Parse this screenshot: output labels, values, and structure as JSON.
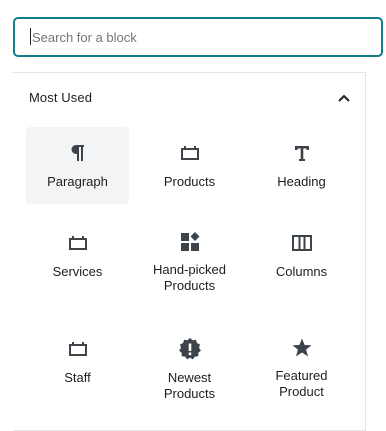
{
  "search": {
    "placeholder": "Search for a block",
    "value": ""
  },
  "section": {
    "title": "Most Used",
    "expanded": true
  },
  "accent_color": "#0f7d8a",
  "blocks": [
    {
      "label": "Paragraph",
      "icon": "paragraph-icon",
      "hovered": true
    },
    {
      "label": "Products",
      "icon": "widget-icon"
    },
    {
      "label": "Heading",
      "icon": "heading-icon"
    },
    {
      "label": "Services",
      "icon": "widget-icon"
    },
    {
      "label": "Hand-picked\nProducts",
      "icon": "grid-icon"
    },
    {
      "label": "Columns",
      "icon": "columns-icon"
    },
    {
      "label": "Staff",
      "icon": "widget-icon"
    },
    {
      "label": "Newest\nProducts",
      "icon": "exclamation-badge-icon"
    },
    {
      "label": "Featured\nProduct",
      "icon": "star-icon"
    }
  ]
}
